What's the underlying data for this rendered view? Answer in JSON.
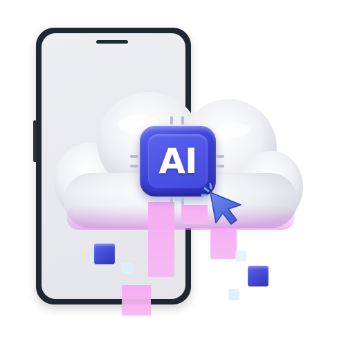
{
  "chip": {
    "label": "AI"
  },
  "colors": {
    "phone_frame": "#1f2731",
    "phone_screen": "#e8eaee",
    "chip": "#4249dd",
    "cursor": "#4a6be0",
    "pink": "#f6aef2",
    "cube_blue": "#3d44d6",
    "cube_ice": "#dbeeff"
  },
  "icons": [
    "phone",
    "cloud",
    "ai-chip",
    "mouse-cursor",
    "cube"
  ]
}
